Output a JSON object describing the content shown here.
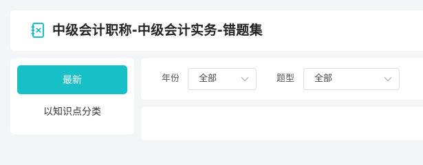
{
  "header": {
    "title": "中级会计职称-中级会计实务-错题集",
    "icon": "notebook-x-icon",
    "accent_color": "#17bfc6"
  },
  "sidebar": {
    "newest_label": "最新",
    "by_knowledge_label": "以知识点分类"
  },
  "filters": {
    "year_label": "年份",
    "year_value": "全部",
    "type_label": "题型",
    "type_value": "全部"
  }
}
